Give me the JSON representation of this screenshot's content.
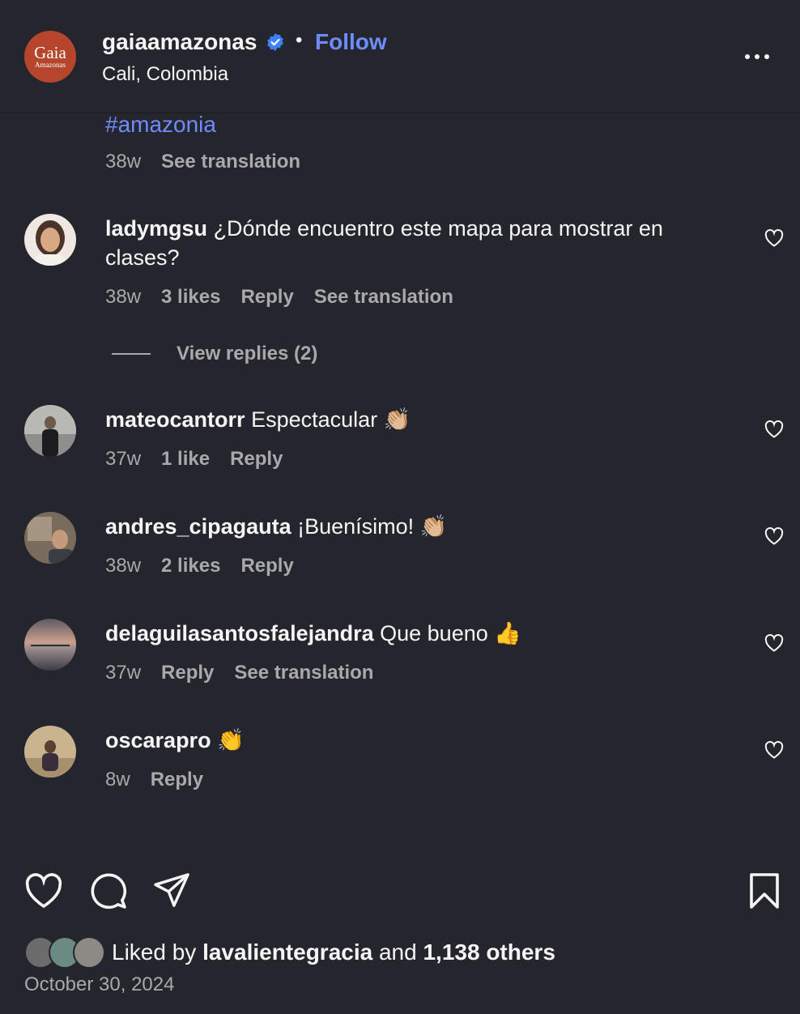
{
  "header": {
    "avatar_text_big": "Gaia",
    "avatar_text_small": "Amazonas",
    "username": "gaiaamazonas",
    "separator": "•",
    "follow_label": "Follow",
    "location": "Cali, Colombia"
  },
  "caption": {
    "hashtag": "#amazonia",
    "age": "38w",
    "see_translation": "See translation"
  },
  "comments": [
    {
      "username": "ladymgsu",
      "text": "¿Dónde encuentro este mapa para mostrar en clases?",
      "age": "38w",
      "likes": "3 likes",
      "reply": "Reply",
      "see_translation": "See translation"
    },
    {
      "username": "mateocantorr",
      "text": "Espectacular 👏🏼",
      "age": "37w",
      "likes": "1 like",
      "reply": "Reply"
    },
    {
      "username": "andres_cipagauta",
      "text": "¡Buenísimo! 👏🏼",
      "age": "38w",
      "likes": "2 likes",
      "reply": "Reply"
    },
    {
      "username": "delaguilasantosfalejandra",
      "text": "Que bueno 👍",
      "age": "37w",
      "reply": "Reply",
      "see_translation": "See translation"
    },
    {
      "username": "oscarapro",
      "text": "👏",
      "age": "8w",
      "reply": "Reply"
    }
  ],
  "view_replies": "View replies (2)",
  "footer": {
    "liked_prefix": "Liked by",
    "liked_user": "lavalientegracia",
    "liked_and": "and",
    "liked_others": "1,138 others",
    "date": "October 30, 2024"
  },
  "icons": [
    "verified-badge-icon",
    "more-options-icon",
    "heart-icon",
    "comment-icon",
    "share-icon",
    "bookmark-icon"
  ],
  "colors": {
    "background": "#25262d",
    "accent_link": "#6f8cff",
    "verified": "#3b82f6",
    "muted": "#a8a8ad"
  }
}
